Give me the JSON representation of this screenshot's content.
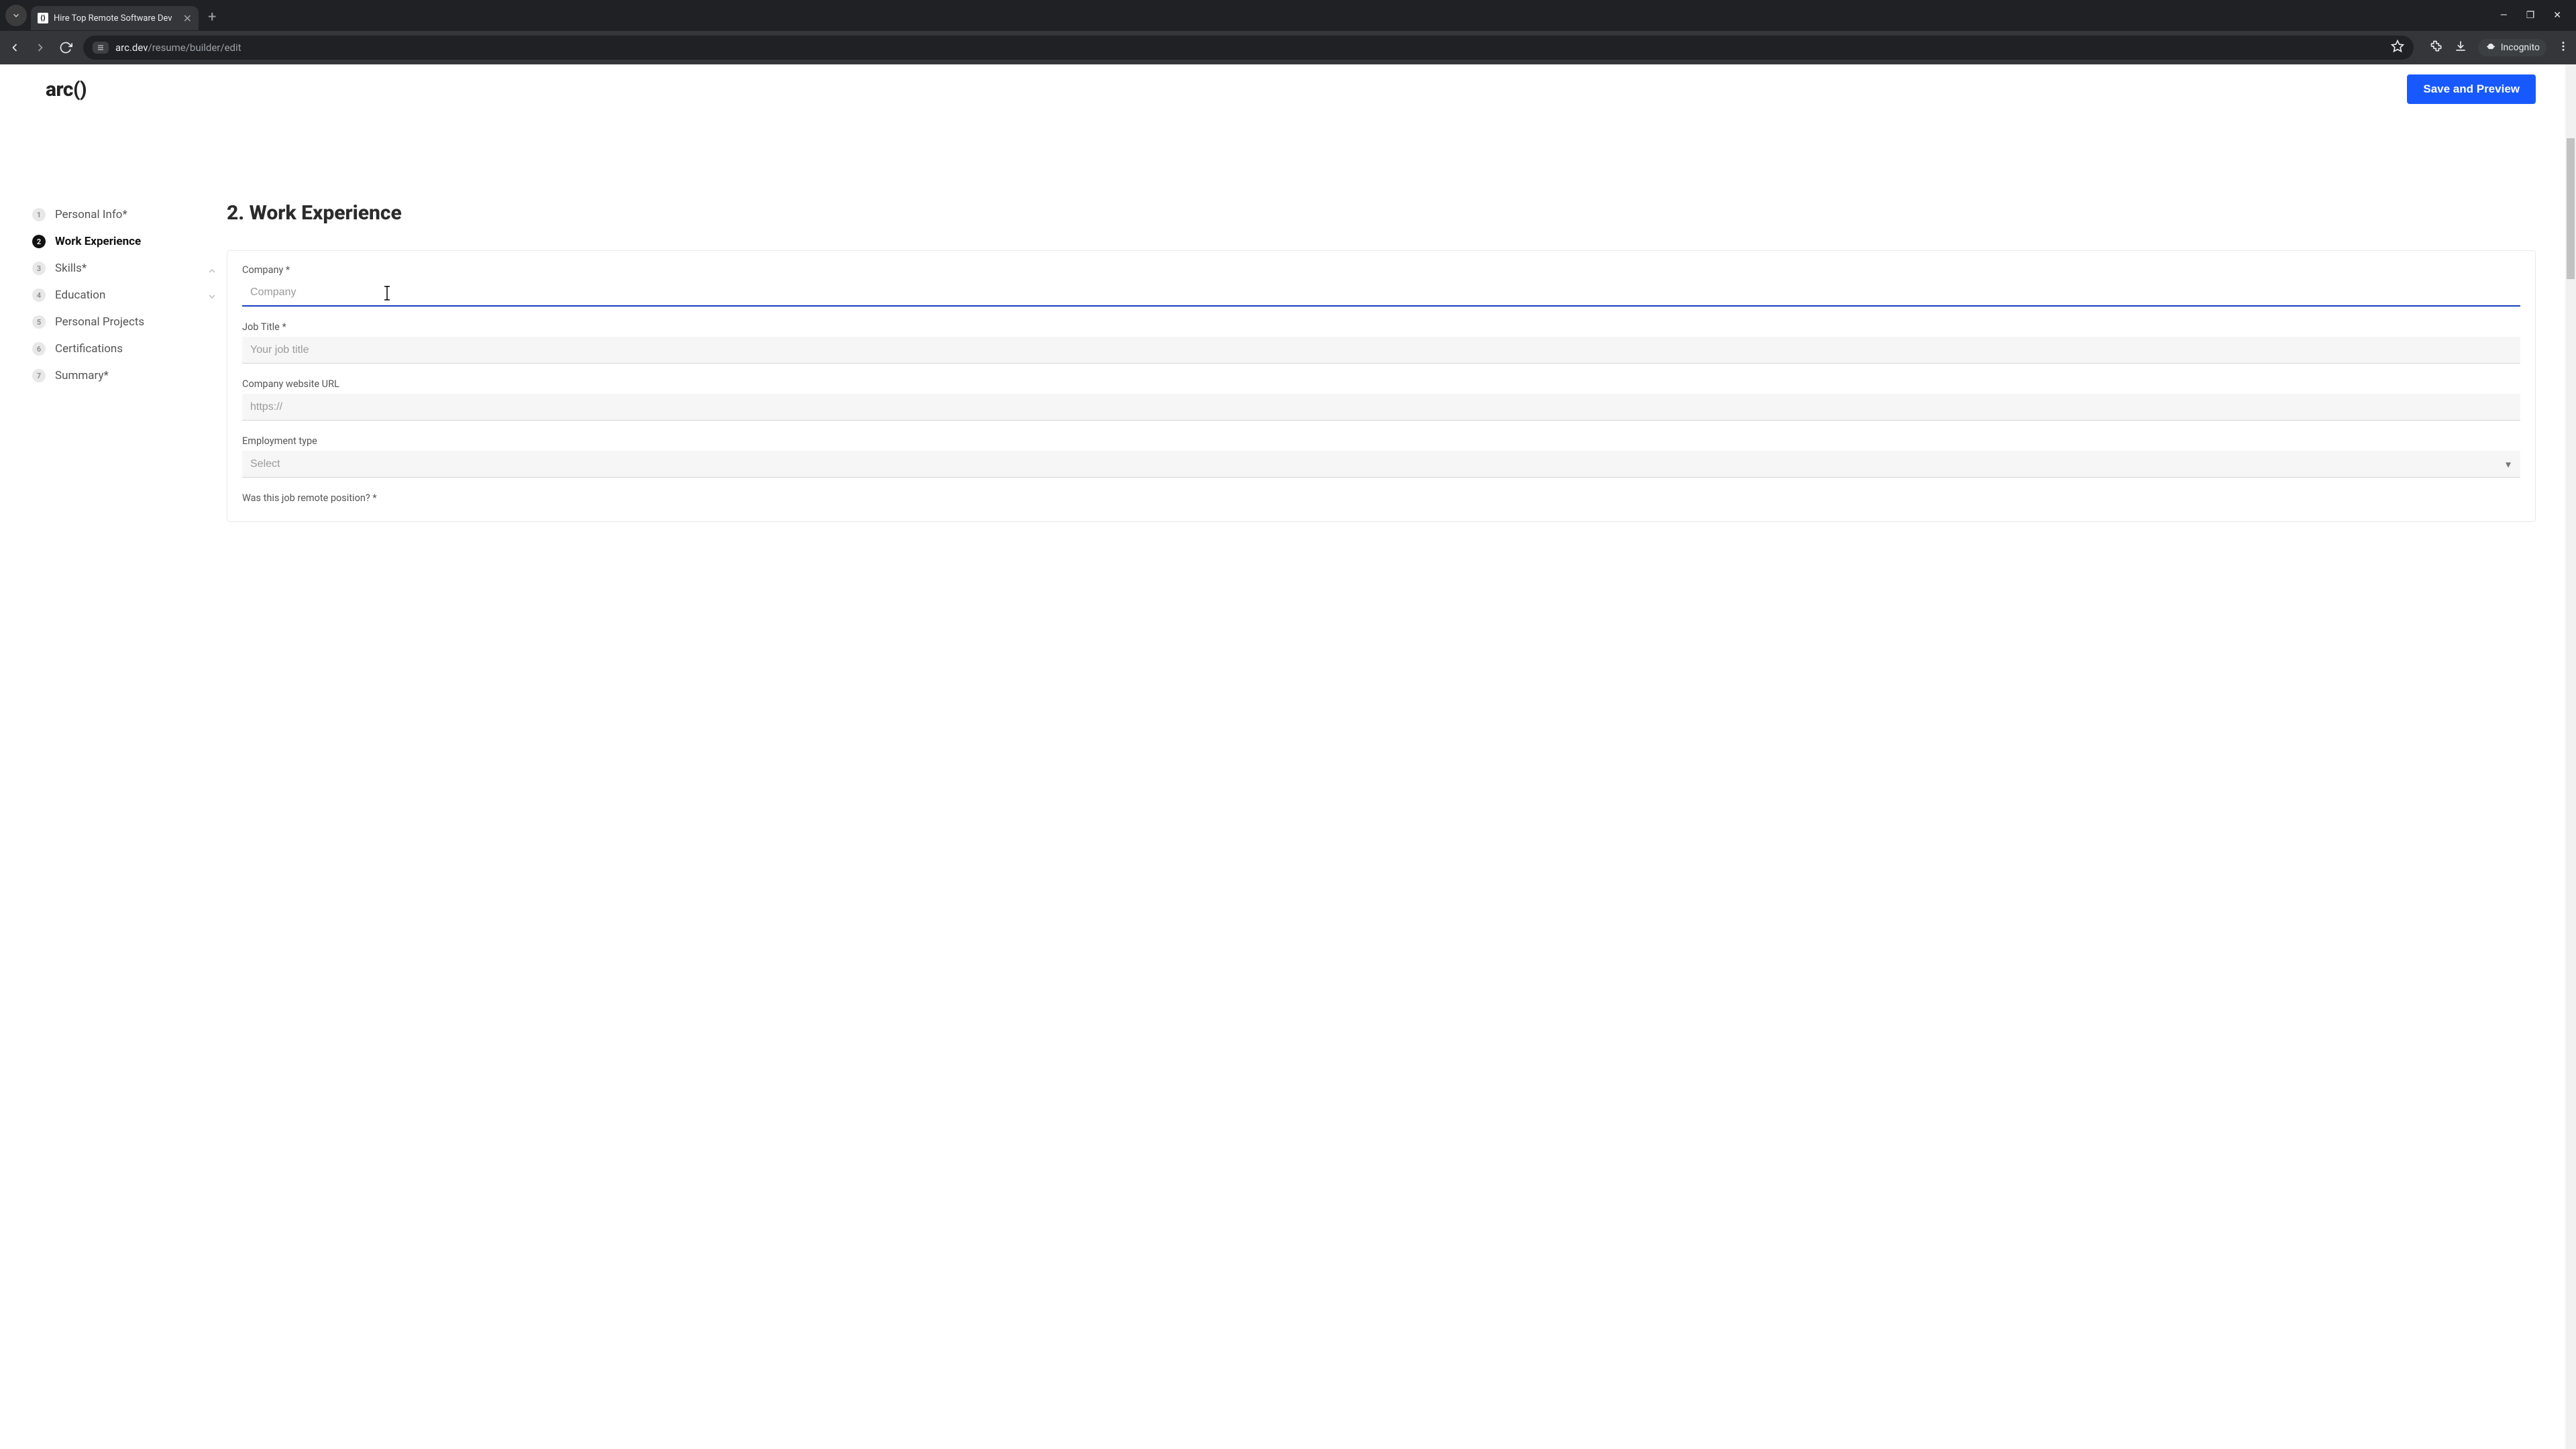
{
  "browser": {
    "tab_title": "Hire Top Remote Software Dev",
    "url_host": "arc.dev",
    "url_path": "/resume/builder/edit",
    "incognito_label": "Incognito"
  },
  "header": {
    "logo_text": "arc()",
    "save_label": "Save and Preview"
  },
  "sidebar": {
    "items": [
      {
        "num": "1",
        "label": "Personal Info*"
      },
      {
        "num": "2",
        "label": "Work Experience"
      },
      {
        "num": "3",
        "label": "Skills*"
      },
      {
        "num": "4",
        "label": "Education"
      },
      {
        "num": "5",
        "label": "Personal Projects"
      },
      {
        "num": "6",
        "label": "Certifications"
      },
      {
        "num": "7",
        "label": "Summary*"
      }
    ],
    "active_index": 1
  },
  "main": {
    "section_title": "2. Work Experience",
    "fields": {
      "company": {
        "label": "Company *",
        "placeholder": "Company",
        "value": ""
      },
      "job_title": {
        "label": "Job Title *",
        "placeholder": "Your job title",
        "value": ""
      },
      "website": {
        "label": "Company website URL",
        "placeholder": "https://",
        "value": ""
      },
      "employment_type": {
        "label": "Employment type",
        "placeholder": "Select",
        "value": ""
      },
      "remote_q": {
        "label": "Was this job remote position? *"
      }
    }
  }
}
